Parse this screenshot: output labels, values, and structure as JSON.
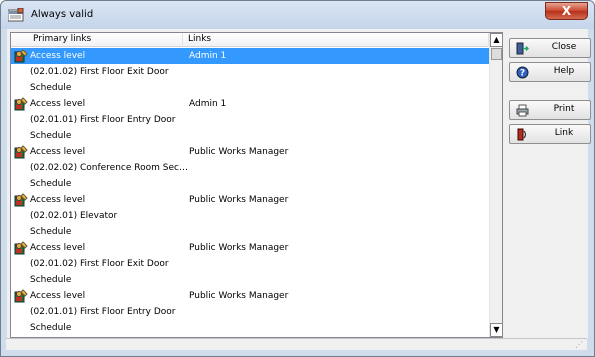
{
  "window": {
    "title": "Always valid",
    "close_label": "X"
  },
  "table": {
    "headers": [
      "Primary links",
      "Links"
    ],
    "rows": [
      {
        "icon": "access-level-icon",
        "primary": "Access level",
        "links": "Admin 1",
        "selected": true
      },
      {
        "icon": "",
        "primary": "(02.01.02) First Floor Exit Door",
        "links": "",
        "selected": false
      },
      {
        "icon": "",
        "primary": "Schedule",
        "links": "",
        "selected": false
      },
      {
        "icon": "access-level-icon",
        "primary": "Access level",
        "links": "Admin 1",
        "selected": false
      },
      {
        "icon": "",
        "primary": "(02.01.01) First Floor Entry Door",
        "links": "",
        "selected": false
      },
      {
        "icon": "",
        "primary": "Schedule",
        "links": "",
        "selected": false
      },
      {
        "icon": "access-level-icon",
        "primary": "Access level",
        "links": "Public Works Manager",
        "selected": false
      },
      {
        "icon": "",
        "primary": "(02.02.02) Conference Room Sec…",
        "links": "",
        "selected": false
      },
      {
        "icon": "",
        "primary": "Schedule",
        "links": "",
        "selected": false
      },
      {
        "icon": "access-level-icon",
        "primary": "Access level",
        "links": "Public Works Manager",
        "selected": false
      },
      {
        "icon": "",
        "primary": "(02.02.01) Elevator",
        "links": "",
        "selected": false
      },
      {
        "icon": "",
        "primary": "Schedule",
        "links": "",
        "selected": false
      },
      {
        "icon": "access-level-icon",
        "primary": "Access level",
        "links": "Public Works Manager",
        "selected": false
      },
      {
        "icon": "",
        "primary": "(02.01.02) First Floor Exit Door",
        "links": "",
        "selected": false
      },
      {
        "icon": "",
        "primary": "Schedule",
        "links": "",
        "selected": false
      },
      {
        "icon": "access-level-icon",
        "primary": "Access level",
        "links": "Public Works Manager",
        "selected": false
      },
      {
        "icon": "",
        "primary": "(02.01.01) First Floor Entry Door",
        "links": "",
        "selected": false
      },
      {
        "icon": "",
        "primary": "Schedule",
        "links": "",
        "selected": false
      }
    ]
  },
  "buttons": {
    "close": {
      "label": "Close",
      "icon": "exit-door-icon"
    },
    "help": {
      "label": "Help",
      "icon": "help-icon"
    },
    "print": {
      "label": "Print",
      "icon": "printer-icon"
    },
    "link": {
      "label": "Link",
      "icon": "link-icon"
    }
  },
  "colors": {
    "selection": "#3399ff",
    "titlebar": "#c4d4ea",
    "close_button": "#c8452c"
  }
}
